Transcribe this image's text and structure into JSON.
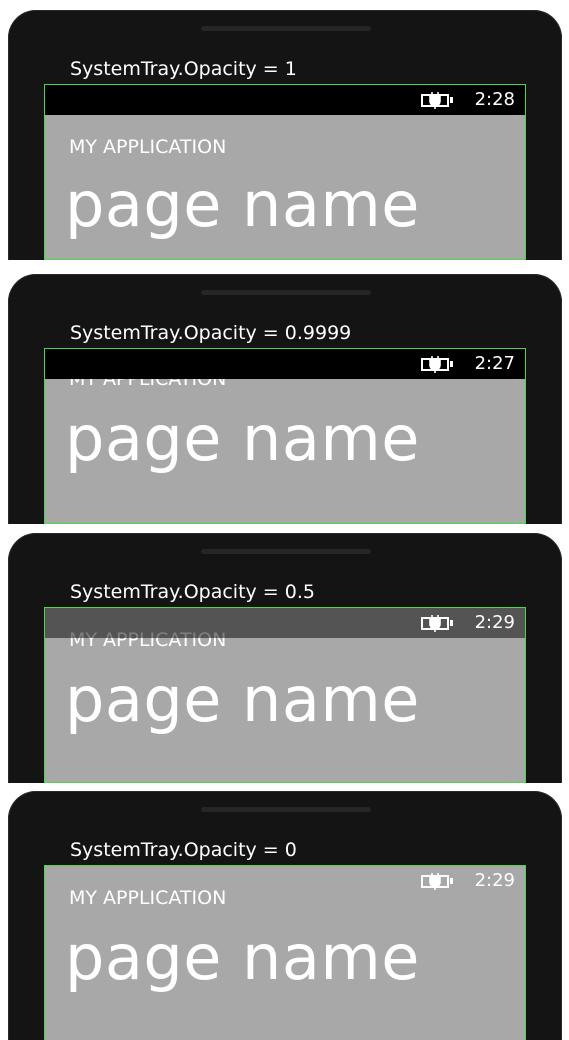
{
  "variants": [
    {
      "caption": "SystemTray.Opacity = 1",
      "tray_opacity": 1,
      "clock": "2:28",
      "app_title": "MY APPLICATION",
      "page_title": "page name"
    },
    {
      "caption": "SystemTray.Opacity = 0.9999",
      "tray_opacity": 0.9999,
      "clock": "2:27",
      "app_title": "MY APPLICATION",
      "page_title": "page name"
    },
    {
      "caption": "SystemTray.Opacity = 0.5",
      "tray_opacity": 0.5,
      "clock": "2:29",
      "app_title": "MY APPLICATION",
      "page_title": "page name"
    },
    {
      "caption": "SystemTray.Opacity = 0",
      "tray_opacity": 0,
      "clock": "2:29",
      "app_title": "MY APPLICATION",
      "page_title": "page name"
    }
  ],
  "icons": {
    "battery": "battery-charging-icon"
  },
  "colors": {
    "phone_bezel": "#141414",
    "screen_background": "#a8a8a8",
    "screen_outline": "#4cd64c",
    "tray_background": "#000000",
    "text": "#ffffff"
  }
}
